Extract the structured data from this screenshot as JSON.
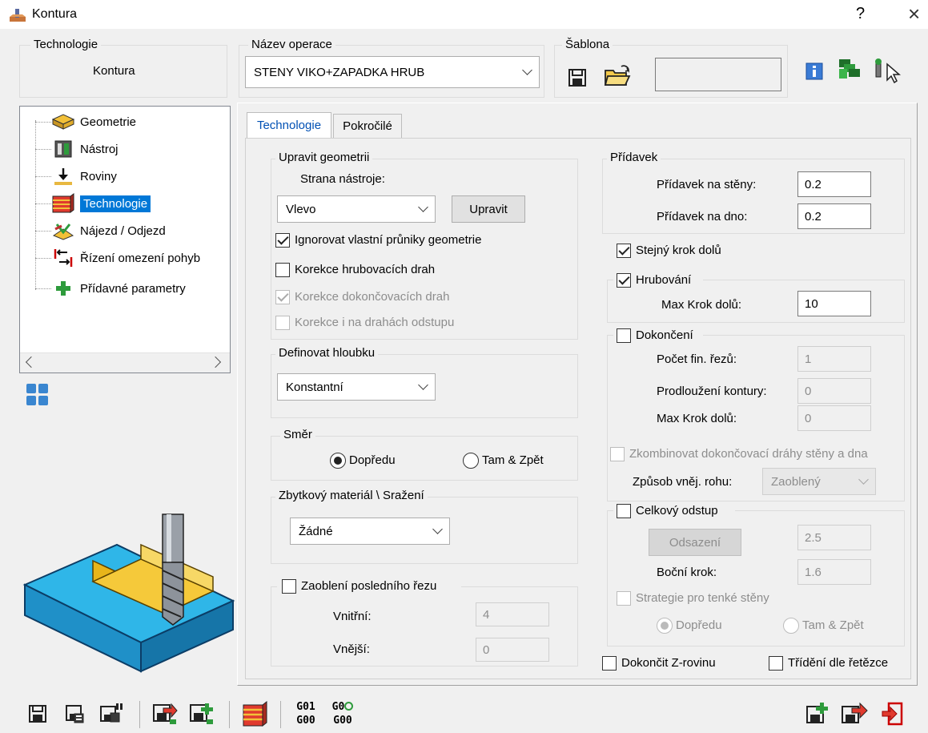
{
  "window": {
    "title": "Kontura",
    "help": "?",
    "close": "×"
  },
  "header": {
    "technologie_title": "Technologie",
    "technologie_value": "Kontura",
    "nazev_title": "Název operace",
    "nazev_value": "STENY VIKO+ZAPADKA HRUB",
    "sablona_title": "Šablona"
  },
  "tree": {
    "items": [
      {
        "label": "Geometrie",
        "icon": "geometry-icon"
      },
      {
        "label": "Nástroj",
        "icon": "tool-icon"
      },
      {
        "label": "Roviny",
        "icon": "planes-icon"
      },
      {
        "label": "Technologie",
        "icon": "technology-icon"
      },
      {
        "label": "Nájezd / Odjezd",
        "icon": "approach-icon"
      },
      {
        "label": "Řízení omezení pohyb",
        "icon": "motion-limit-icon"
      },
      {
        "label": "Přídavné parametry",
        "icon": "plus-icon"
      }
    ],
    "selected_index": 3
  },
  "tabs": [
    {
      "label": "Technologie"
    },
    {
      "label": "Pokročilé"
    }
  ],
  "upravit": {
    "title": "Upravit geometrii",
    "strana_label": "Strana nástroje:",
    "strana_value": "Vlevo",
    "upravit_button": "Upravit",
    "ignorovat": "Ignorovat vlastní průniky geometrie",
    "korekce_hrub": "Korekce hrubovacích drah",
    "korekce_dok": "Korekce dokončovacích drah",
    "korekce_odstup": "Korekce i na drahách odstupu"
  },
  "hloubka": {
    "title": "Definovat hloubku",
    "value": "Konstantní"
  },
  "smer": {
    "title": "Směr",
    "dopredu": "Dopředu",
    "tam": "Tam & Zpět"
  },
  "zbytkovy": {
    "title": "Zbytkový materiál \\ Sražení",
    "value": "Žádné"
  },
  "zaobleni": {
    "title": "Zaoblení posledního řezu",
    "vnitrni_label": "Vnitřní:",
    "vnitrni_value": "4",
    "vnejsi_label": "Vnější:",
    "vnejsi_value": "0"
  },
  "pridavek": {
    "title": "Přídavek",
    "steny_label": "Přídavek na stěny:",
    "steny_value": "0.2",
    "dno_label": "Přídavek na dno:",
    "dno_value": "0.2"
  },
  "stejny_krok": "Stejný krok dolů",
  "hrubovani": {
    "title": "Hrubování",
    "max_krok_label": "Max Krok dolů:",
    "max_krok_value": "10"
  },
  "dokonceni": {
    "title": "Dokončení",
    "pocet_label": "Počet fin. řezů:",
    "pocet_value": "1",
    "prodlouzeni_label": "Prodloužení kontury:",
    "prodlouzeni_value": "0",
    "max_krok_label": "Max Krok dolů:",
    "max_krok_value": "0",
    "zkombinovat": "Zkombinovat dokončovací dráhy stěny a dna",
    "zpusob_label": "Způsob vněj. rohu:",
    "zpusob_value": "Zaoblený"
  },
  "celkovy": {
    "title": "Celkový odstup",
    "odsazeni_button": "Odsazení",
    "odsazeni_value": "2.5",
    "bocni_label": "Boční krok:",
    "bocni_value": "1.6",
    "strategie": "Strategie pro tenké stěny",
    "dopredu": "Dopředu",
    "tam": "Tam & Zpět"
  },
  "dokoncit_z": "Dokončit Z-rovinu",
  "trideni": "Třídění dle řetězce",
  "gcode": {
    "g01": "G01",
    "g0": "G0",
    "g00a": "G00",
    "g00b": "G00"
  },
  "colors": {
    "accent": "#0078d7",
    "selection": "#0078d7"
  }
}
